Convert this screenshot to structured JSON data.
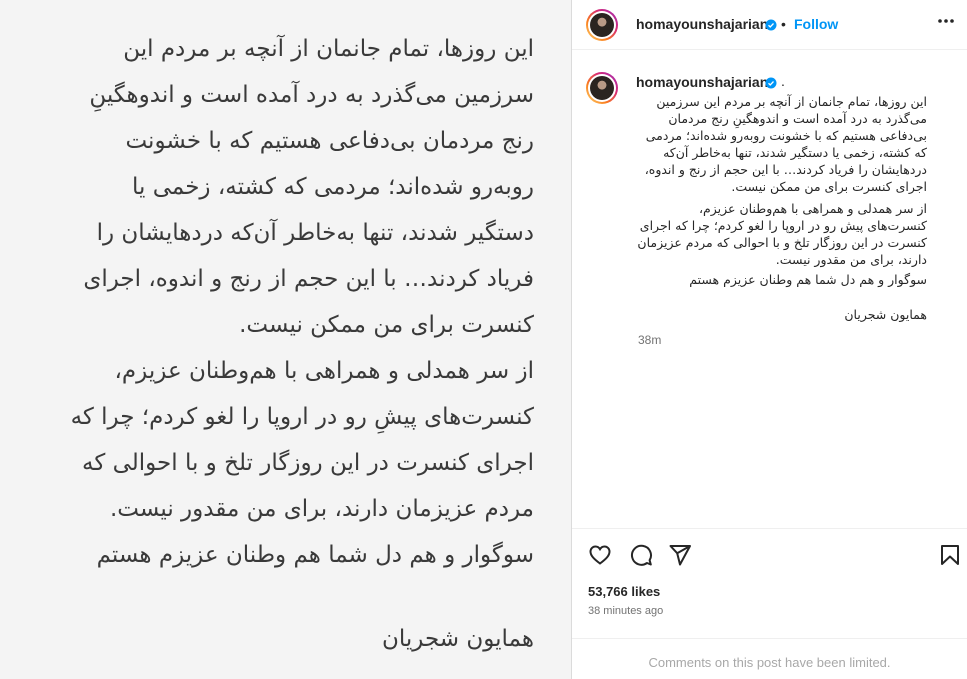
{
  "image_text": {
    "lines": [
      "این روزها، تمام جانمان از آنچه بر مردم این",
      "سرزمین می‌گذرد به درد آمده است و اندوهگینِ",
      "رنج مردمان بی‌دفاعی هستیم که با خشونت",
      "روبه‌رو شده‌اند؛ مردمی که کشته، زخمی یا",
      "دستگیر شدند، تنها به‌خاطر آن‌که دردهایشان را",
      "فریاد کردند… با این حجم از رنج و اندوه، اجرای",
      "کنسرت برای من ممکن نیست.",
      "از سر همدلی و همراهی با هم‌وطنان عزیزم،",
      "کنسرت‌های پیشِ رو در اروپا را لغو کردم؛ چرا که",
      "اجرای کنسرت در این روزگار تلخ و با احوالی که",
      "مردم عزیزمان دارند، برای من مقدور نیست.",
      "سوگوار و هم دل شما هم وطنان عزیزم هستم",
      "همایون شجریان"
    ]
  },
  "header": {
    "username": "homayounshajarian",
    "separator": "•",
    "follow_label": "Follow",
    "more_icon": "more-horizontal-icon"
  },
  "caption": {
    "username": "homayounshajarian",
    "trailing": ".",
    "lines": [
      "این روزها، تمام جانمان از آنچه بر مردم این سرزمین",
      "می‌گذرد به درد آمده است و اندوهگینِ رنج مردمان",
      "بی‌دفاعی هستیم که با خشونت روبه‌رو شده‌اند؛ مردمی",
      "که کشته، زخمی یا دستگیر شدند، تنها به‌خاطر آن‌که",
      "دردهایشان را فریاد کردند… با این حجم از رنج و اندوه،",
      "اجرای کنسرت برای من ممکن نیست.",
      "از سر همدلی و همراهی با هم‌وطنان عزیزم،",
      "کنسرت‌های پیش رو در اروپا را لغو کردم؛ چرا که اجرای",
      "کنسرت در این روزگار تلخ و با احوالی که مردم عزیزمان",
      "دارند، برای من مقدور نیست.",
      "سوگوار و هم دل شما هم وطنان عزیزم هستم",
      "همایون شجریان"
    ],
    "time": "38m"
  },
  "actions": {
    "icons": [
      "heart-icon",
      "comment-icon",
      "share-icon",
      "bookmark-icon"
    ],
    "likes": "53,766 likes",
    "posted_ago": "38 minutes ago",
    "comments_notice": "Comments on this post have been limited."
  },
  "colors": {
    "accent": "#0095f6",
    "verified": "#0095f6",
    "text": "#262626",
    "muted": "#737373"
  }
}
